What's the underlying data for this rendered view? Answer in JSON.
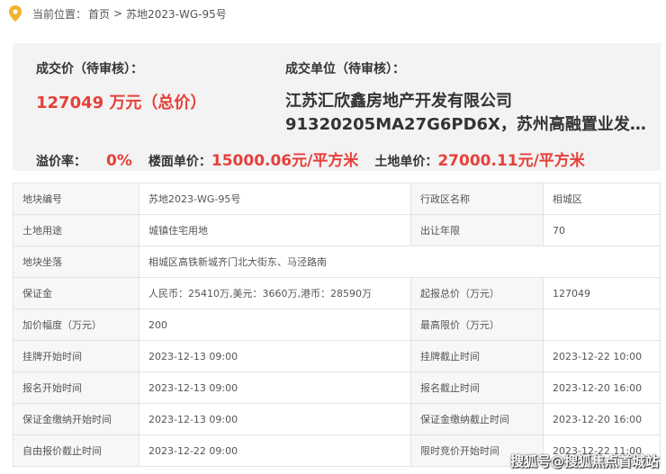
{
  "breadcrumb": {
    "label": "当前位置：",
    "home": "首页",
    "separator": ">",
    "current": "苏地2023-WG-95号"
  },
  "summary": {
    "price_label": "成交价（待审核）：",
    "price_value": "127049 万元（总价）",
    "buyer_label": "成交单位（待审核）：",
    "buyer_line1": "江苏汇欣鑫房地产开发有限公司",
    "buyer_line2": "91320205MA27G6PD6X，苏州高融置业发…",
    "premium_label": "溢价率：",
    "premium_value": "0%",
    "floor_price_label": "楼面单价：",
    "floor_price_value": "15000.06元/平方米",
    "land_price_label": "土地单价：",
    "land_price_value": "27000.11元/平方米"
  },
  "table": {
    "rows": [
      [
        "地块编号",
        "苏地2023-WG-95号",
        "行政区名称",
        "相城区"
      ],
      [
        "土地用途",
        "城镇住宅用地",
        "出让年限",
        "70"
      ],
      [
        "地块坐落",
        "相城区高铁新城齐门北大街东、马泾路南"
      ],
      [
        "保证金",
        "人民币：25410万,美元：3660万,港币：28590万",
        "起报总价（万元）",
        "127049"
      ],
      [
        "加价幅度（万元）",
        "200",
        "最高限价（万元）",
        ""
      ],
      [
        "挂牌开始时间",
        "2023-12-13 09:00",
        "挂牌截止时间",
        "2023-12-22 10:00"
      ],
      [
        "报名开始时间",
        "2023-12-13 09:00",
        "报名截止时间",
        "2023-12-20 16:00"
      ],
      [
        "保证金缴纳开始时间",
        "2023-12-13 09:00",
        "保证金缴纳截止时间",
        "2023-12-20 16:00"
      ],
      [
        "自由报价截止时间",
        "2023-12-22 09:00",
        "限时竞价开始时间",
        "2023-12-22 11:00"
      ]
    ]
  },
  "watermark": "搜狐号@搜狐焦点首城站",
  "colors": {
    "accent_red": "#e6403a",
    "pin_yellow": "#f0b429",
    "panel_bg": "#f3f3f3"
  }
}
